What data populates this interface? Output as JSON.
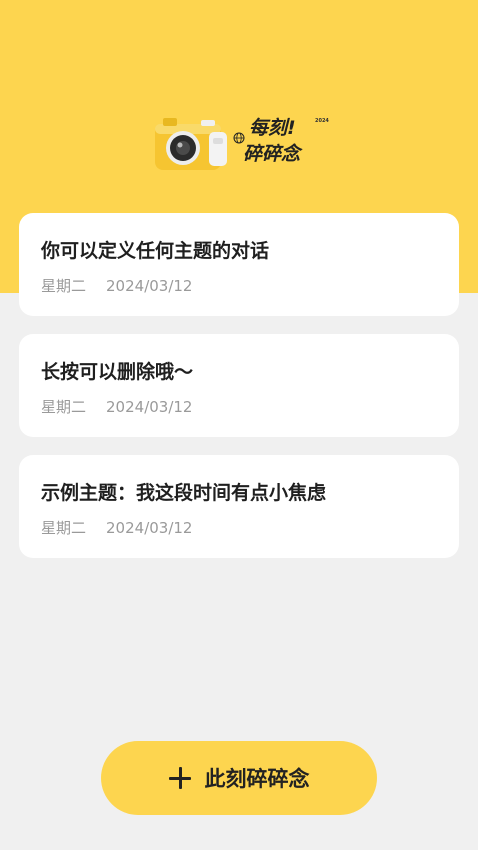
{
  "header": {
    "logo": {
      "line1": "每刻!",
      "line2": "碎碎念",
      "year": "2024"
    }
  },
  "topics": [
    {
      "title": "你可以定义任何主题的对话",
      "weekday": "星期二",
      "date": "2024/03/12"
    },
    {
      "title": "长按可以删除哦～",
      "weekday": "星期二",
      "date": "2024/03/12"
    },
    {
      "title": "示例主题：我这段时间有点小焦虑",
      "weekday": "星期二",
      "date": "2024/03/12"
    }
  ],
  "add_button": {
    "label": "此刻碎碎念",
    "icon": "plus-icon"
  },
  "colors": {
    "accent": "#FDD54F",
    "background": "#F0F0F0",
    "card": "#FFFFFF"
  }
}
